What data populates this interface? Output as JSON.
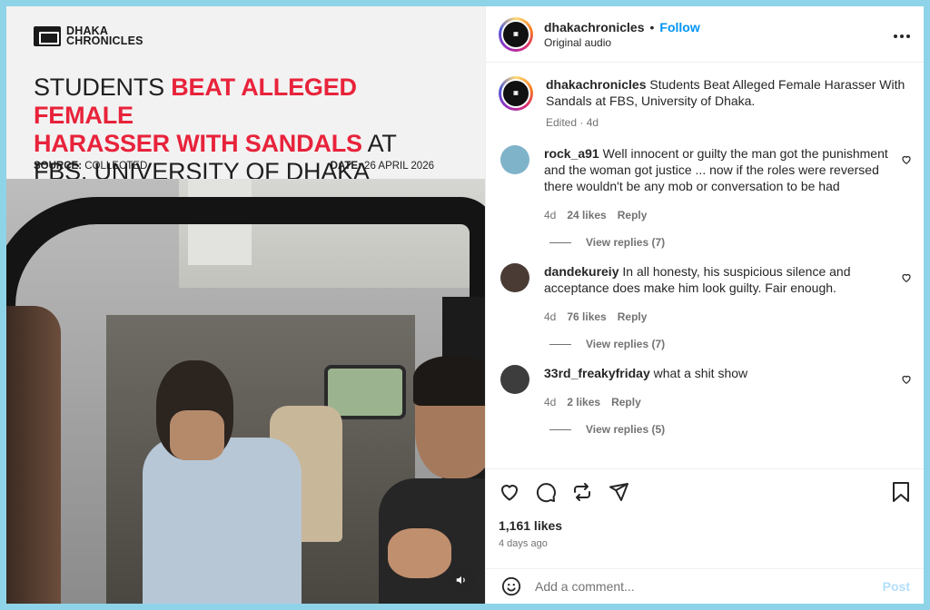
{
  "media": {
    "brand": "DHAKA CHRONICLES",
    "headline_normal_1": "STUDENTS ",
    "headline_red_1": "BEAT ALLEGED FEMALE",
    "headline_red_2": "HARASSER WITH SANDALS",
    "headline_normal_2": " AT",
    "headline_normal_3": "FBS, UNIVERSITY OF DHAKA",
    "source_label": "SOURCE:",
    "source_value": "COLLECTED",
    "date_label": "DATE:",
    "date_value": "26 APRIL 2026",
    "sound_icon": "speaker-icon"
  },
  "header": {
    "username": "dhakachronicles",
    "separator": "•",
    "follow": "Follow",
    "subtitle": "Original audio",
    "more": "•••"
  },
  "caption": {
    "username": "dhakachronicles",
    "text": "Students Beat Alleged Female Harasser With Sandals at FBS, University of Dhaka.",
    "meta": "Edited · 4d"
  },
  "comments": [
    {
      "username": "rock_a91",
      "text": "Well innocent or guilty the man got the punishment and the woman got justice ... now if the roles were reversed there wouldn't be any mob or conversation to be had",
      "age": "4d",
      "likes": "24 likes",
      "reply": "Reply",
      "view_replies": "View replies (7)",
      "avatar_color": "#7fb3c9"
    },
    {
      "username": "dandekureiy",
      "text": "In all honesty, his suspicious silence and acceptance does make him look guilty. Fair enough.",
      "age": "4d",
      "likes": "76 likes",
      "reply": "Reply",
      "view_replies": "View replies (7)",
      "avatar_color": "#4a3b35"
    },
    {
      "username": "33rd_freakyfriday",
      "text": "what a shit show",
      "age": "4d",
      "likes": "2 likes",
      "reply": "Reply",
      "view_replies": "View replies (5)",
      "avatar_color": "#3d3d3d"
    }
  ],
  "actions": {
    "likes": "1,161 likes",
    "ago": "4 days ago"
  },
  "add_comment": {
    "placeholder": "Add a comment...",
    "post": "Post"
  }
}
